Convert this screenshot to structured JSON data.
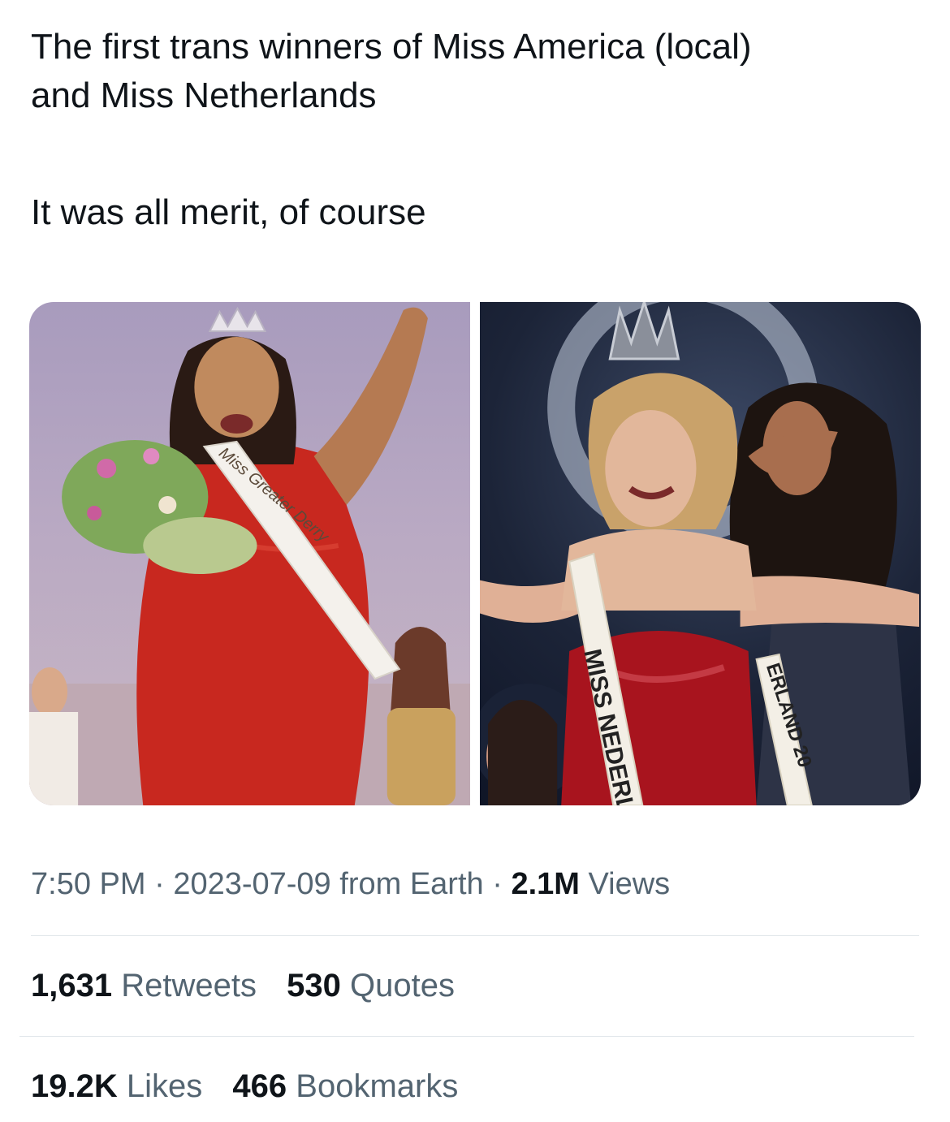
{
  "tweet": {
    "lines": [
      "The first trans winners of Miss America (local)",
      "and Miss Netherlands",
      "It was all merit, of course"
    ]
  },
  "media": {
    "left_photo": {
      "sash_text": "Miss Greater Derry"
    },
    "right_photo": {
      "sash_text": "MISS NEDERL",
      "sash_text_2": "ERLAND 20"
    }
  },
  "meta": {
    "time": "7:50 PM",
    "separator": "·",
    "date": "2023-07-09",
    "source": "from Earth",
    "views_count": "2.1M",
    "views_label": "Views"
  },
  "stats": {
    "retweets_count": "1,631",
    "retweets_label": "Retweets",
    "quotes_count": "530",
    "quotes_label": "Quotes",
    "likes_count": "19.2K",
    "likes_label": "Likes",
    "bookmarks_count": "466",
    "bookmarks_label": "Bookmarks"
  },
  "colors": {
    "text_primary": "#0f1419",
    "text_secondary": "#536471",
    "divider": "#e1e6ea"
  }
}
